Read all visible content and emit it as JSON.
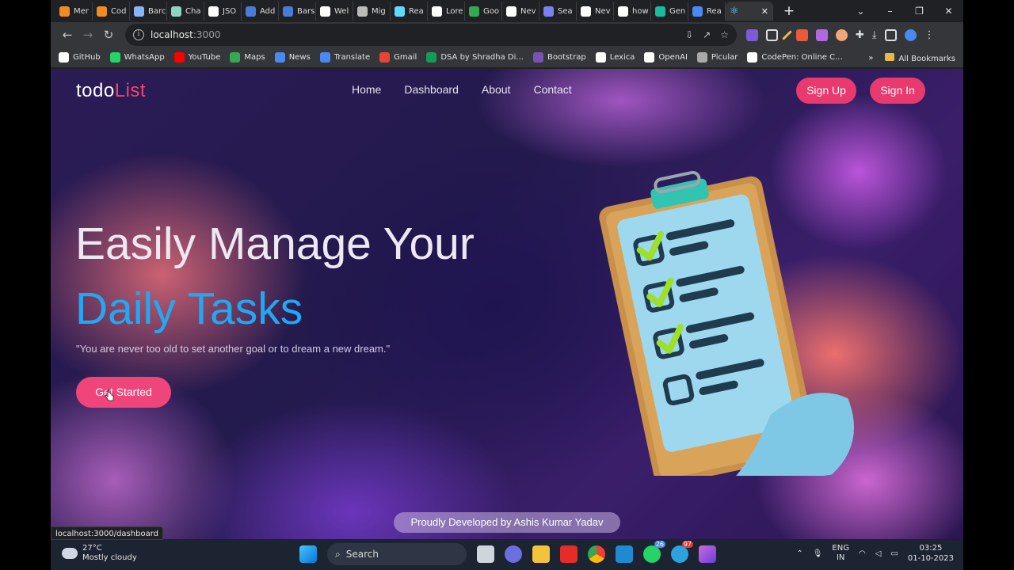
{
  "browser": {
    "tabs": [
      "Mer",
      "Cod",
      "Barc",
      "Cha",
      "JSO",
      "Add",
      "Bars",
      "Wel",
      "Mig",
      "Rea",
      "Lore",
      "Goo",
      "Nev",
      "Sea",
      "Nev",
      "how",
      "Gen",
      "Rea"
    ],
    "tab_favicon_colors": [
      "#f28b24",
      "#f28b24",
      "#8ab4f8",
      "#8fd3c0",
      "#ffffff",
      "#4a7bd6",
      "#4a7bd6",
      "#ffffff",
      "#bbbbbb",
      "#61dafb",
      "#ffffff",
      "#34a853",
      "#ffffff",
      "#7a80f0",
      "#ffffff",
      "#ffffff",
      "#1abc9c",
      "#4a89f3"
    ],
    "active_tab_icon": "react-icon",
    "new_tab": "+",
    "url_host": "localhost",
    "url_port": ":3000",
    "controls": {
      "minimize": "–",
      "maximize": "❐",
      "close": "✕",
      "dropdown": "⌄"
    }
  },
  "bookmarks": [
    {
      "label": "GitHub",
      "color": "#ffffff"
    },
    {
      "label": "WhatsApp",
      "color": "#25d366"
    },
    {
      "label": "YouTube",
      "color": "#ff0000"
    },
    {
      "label": "Maps",
      "color": "#34a853"
    },
    {
      "label": "News",
      "color": "#4a89f3"
    },
    {
      "label": "Translate",
      "color": "#4a89f3"
    },
    {
      "label": "Gmail",
      "color": "#ea4335"
    },
    {
      "label": "DSA by Shradha Di...",
      "color": "#0f9d58"
    },
    {
      "label": "Bootstrap",
      "color": "#7952b3"
    },
    {
      "label": "Lexica",
      "color": "#ffffff"
    },
    {
      "label": "OpenAI",
      "color": "#ffffff"
    },
    {
      "label": "Picular",
      "color": "#aaaaaa"
    },
    {
      "label": "CodePen: Online C...",
      "color": "#ffffff"
    }
  ],
  "bookmarks_more": "»",
  "all_bookmarks": "All Bookmarks",
  "page": {
    "logo_main": "todo",
    "logo_accent": "List",
    "nav": [
      "Home",
      "Dashboard",
      "About",
      "Contact"
    ],
    "signup": "Sign Up",
    "signin": "Sign In",
    "headline_1": "Easily Manage Your",
    "headline_2": "Daily Tasks",
    "quote": "\"You are never too old to set another goal or to dream a new dream.\"",
    "cta": "Get Started",
    "footer": "Proudly Developed by Ashis Kumar Yadav",
    "colors": {
      "accent_pink": "#e83a6e",
      "headline_blue": "#22a8f2"
    }
  },
  "status_url": "localhost:3000/dashboard",
  "taskbar": {
    "temperature": "27°C",
    "weather": "Mostly cloudy",
    "search": "Search",
    "lang_1": "ENG",
    "lang_2": "IN",
    "time": "03:25",
    "date": "01-10-2023",
    "badges": {
      "whatsapp": "26",
      "telegram": "97"
    }
  }
}
